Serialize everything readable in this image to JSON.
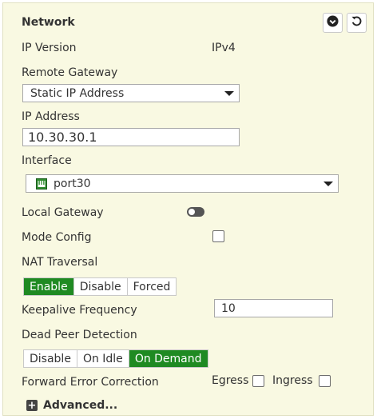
{
  "header": {
    "title": "Network",
    "collapse_icon": "chevron-circle-down-icon",
    "reset_icon": "undo-icon"
  },
  "ip_version": {
    "label": "IP Version",
    "value": "IPv4"
  },
  "remote_gateway": {
    "label": "Remote Gateway",
    "value": "Static IP Address"
  },
  "ip_address": {
    "label": "IP Address",
    "value": "10.30.30.1"
  },
  "interface": {
    "label": "Interface",
    "value": "port30",
    "icon": "network-port-icon"
  },
  "local_gateway": {
    "label": "Local Gateway",
    "enabled": false
  },
  "mode_config": {
    "label": "Mode Config",
    "checked": false
  },
  "nat_traversal": {
    "label": "NAT Traversal",
    "options": [
      "Enable",
      "Disable",
      "Forced"
    ],
    "selected": "Enable"
  },
  "keepalive": {
    "label": "Keepalive Frequency",
    "value": "10"
  },
  "dead_peer_detection": {
    "label": "Dead Peer Detection",
    "options": [
      "Disable",
      "On Idle",
      "On Demand"
    ],
    "selected": "On Demand"
  },
  "fec": {
    "label": "Forward Error Correction",
    "egress_label": "Egress",
    "ingress_label": "Ingress",
    "egress_checked": false,
    "ingress_checked": false
  },
  "advanced": {
    "label": "Advanced...",
    "icon": "plus-square-icon"
  },
  "colors": {
    "panel_bg": "#f9f9e2",
    "selected_green": "#1f8a22",
    "port_icon_green": "#2e8b2e"
  }
}
